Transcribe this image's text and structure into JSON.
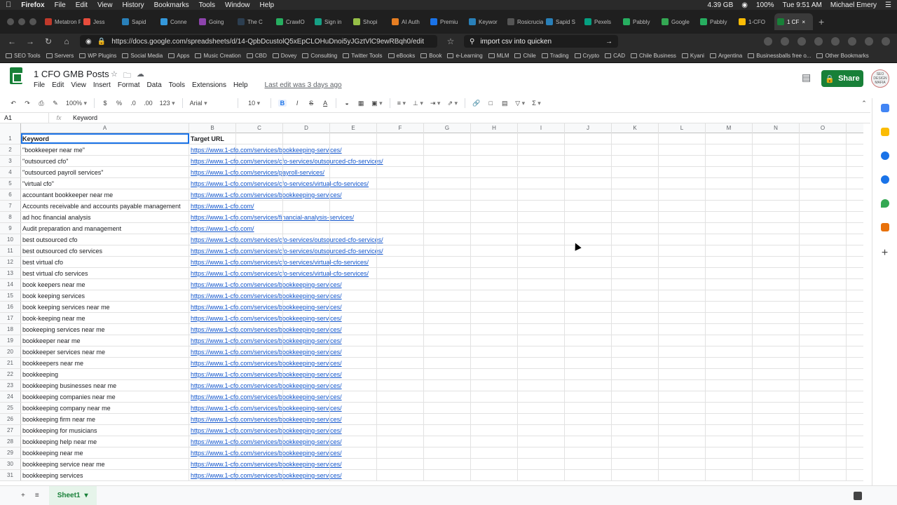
{
  "macbar": {
    "app": "Firefox",
    "menus": [
      "File",
      "Edit",
      "View",
      "History",
      "Bookmarks",
      "Tools",
      "Window",
      "Help"
    ],
    "memory": "4.39 GB",
    "battery": "100%",
    "time": "Tue 9:51 AM",
    "user": "Michael Emery"
  },
  "tabs": [
    {
      "label": "Metatron P",
      "color": "#c0392b"
    },
    {
      "label": "Jess",
      "color": "#e74c3c"
    },
    {
      "label": "Sapid",
      "color": "#2980b9"
    },
    {
      "label": "Conne",
      "color": "#3498db"
    },
    {
      "label": "Going",
      "color": "#8e44ad"
    },
    {
      "label": "The C",
      "color": "#2c3e50"
    },
    {
      "label": "CrawlO",
      "color": "#27ae60"
    },
    {
      "label": "Sign in",
      "color": "#16a085"
    },
    {
      "label": "Shopi",
      "color": "#95bf47"
    },
    {
      "label": "AI Auth",
      "color": "#e67e22"
    },
    {
      "label": "Premiu",
      "color": "#1a73e8"
    },
    {
      "label": "Keywor",
      "color": "#2980b9"
    },
    {
      "label": "Rosicrucia",
      "color": "#555555"
    },
    {
      "label": "Sapid S",
      "color": "#2980b9"
    },
    {
      "label": "Pexels",
      "color": "#05a081"
    },
    {
      "label": "Pabbly",
      "color": "#27ae60"
    },
    {
      "label": "Google",
      "color": "#34a853"
    },
    {
      "label": "Pabbly",
      "color": "#27ae60"
    },
    {
      "label": "1-CFO",
      "color": "#fbbc05"
    },
    {
      "label": "1 CF",
      "color": "#188038",
      "active": true
    }
  ],
  "nav": {
    "url": "https://docs.google.com/spreadsheets/d/14-QpbDcustolQ5xEpCLOHuDnoi5yJGztVlC9ewRBqh0/edit",
    "search": "import csv into quicken"
  },
  "bookmarks": [
    "SEO Tools",
    "Servers",
    "WP Plugins",
    "Social Media",
    "Apps",
    "Music Creation",
    "CBD",
    "Dovey",
    "Consulting",
    "Twitter Tools",
    "eBooks",
    "Book",
    "e-Learning",
    "MLM",
    "Chile",
    "Trading",
    "Crypto",
    "CAD",
    "Chile Business",
    "Kyani",
    "Argentina",
    "Businessballs free o...",
    "Other Bookmarks"
  ],
  "doc": {
    "title": "1 CFO GMB Posts",
    "menus": [
      "File",
      "Edit",
      "View",
      "Insert",
      "Format",
      "Data",
      "Tools",
      "Extensions",
      "Help"
    ],
    "last_edit": "Last edit was 3 days ago",
    "share": "Share",
    "avatar": "SEO DESIGN MAFIA"
  },
  "toolbar": {
    "zoom": "100%",
    "currency": "$",
    "percent": "%",
    "dec_less": ".0",
    "dec_more": ".00",
    "format123": "123",
    "font": "Arial",
    "size": "10",
    "bold": "B",
    "italic": "I",
    "strike": "S",
    "textcolor": "A"
  },
  "formula": {
    "cell": "A1",
    "fx": "fx",
    "value": "Keyword"
  },
  "columns": [
    "A",
    "B",
    "C",
    "D",
    "E",
    "F",
    "G",
    "H",
    "I",
    "J",
    "K",
    "L",
    "M",
    "N",
    "O"
  ],
  "rows": [
    [
      "Keyword",
      "Target URL"
    ],
    [
      "\"bookkeeper near me\"",
      "https://www.1-cfo.com/services/bookkeeping-services/"
    ],
    [
      "\"outsourced cfo\"",
      "https://www.1-cfo.com/services/cfo-services/outsourced-cfo-services/"
    ],
    [
      "\"outsourced payroll services\"",
      "https://www.1-cfo.com/services/payroll-services/"
    ],
    [
      "\"virtual cfo\"",
      "https://www.1-cfo.com/services/cfo-services/virtual-cfo-services/"
    ],
    [
      "accountant bookkeeper near me",
      "https://www.1-cfo.com/services/bookkeeping-services/"
    ],
    [
      "Accounts receivable and accounts payable management",
      "https://www.1-cfo.com/"
    ],
    [
      "ad hoc financial analysis",
      "https://www.1-cfo.com/services/financial-analysis-services/"
    ],
    [
      "Audit preparation and management",
      "https://www.1-cfo.com/"
    ],
    [
      "best outsourced cfo",
      "https://www.1-cfo.com/services/cfo-services/outsourced-cfo-services/"
    ],
    [
      "best outsourced cfo services",
      "https://www.1-cfo.com/services/cfo-services/outsourced-cfo-services/"
    ],
    [
      "best virtual cfo",
      "https://www.1-cfo.com/services/cfo-services/virtual-cfo-services/"
    ],
    [
      "best virtual cfo services",
      "https://www.1-cfo.com/services/cfo-services/virtual-cfo-services/"
    ],
    [
      "book keepers near me",
      "https://www.1-cfo.com/services/bookkeeping-services/"
    ],
    [
      "book keeping services",
      "https://www.1-cfo.com/services/bookkeeping-services/"
    ],
    [
      "book keeping services near me",
      "https://www.1-cfo.com/services/bookkeeping-services/"
    ],
    [
      "book-keeping near me",
      "https://www.1-cfo.com/services/bookkeeping-services/"
    ],
    [
      "bookeeping services near me",
      "https://www.1-cfo.com/services/bookkeeping-services/"
    ],
    [
      "bookkeeper near me",
      "https://www.1-cfo.com/services/bookkeeping-services/"
    ],
    [
      "bookkeeper services near me",
      "https://www.1-cfo.com/services/bookkeeping-services/"
    ],
    [
      "bookkeepers near me",
      "https://www.1-cfo.com/services/bookkeeping-services/"
    ],
    [
      "bookkeeping",
      "https://www.1-cfo.com/services/bookkeeping-services/"
    ],
    [
      "bookkeeping businesses near me",
      "https://www.1-cfo.com/services/bookkeeping-services/"
    ],
    [
      "bookkeeping companies near me",
      "https://www.1-cfo.com/services/bookkeeping-services/"
    ],
    [
      "bookkeeping company near me",
      "https://www.1-cfo.com/services/bookkeeping-services/"
    ],
    [
      "bookkeeping firm near me",
      "https://www.1-cfo.com/services/bookkeeping-services/"
    ],
    [
      "bookkeeping for musicians",
      "https://www.1-cfo.com/services/bookkeeping-services/"
    ],
    [
      "bookkeeping help near me",
      "https://www.1-cfo.com/services/bookkeeping-services/"
    ],
    [
      "bookkeeping near me",
      "https://www.1-cfo.com/services/bookkeeping-services/"
    ],
    [
      "bookkeeping service near me",
      "https://www.1-cfo.com/services/bookkeeping-services/"
    ],
    [
      "bookkeeping services",
      "https://www.1-cfo.com/services/bookkeeping-services/"
    ]
  ],
  "sheet_tab": "Sheet1"
}
